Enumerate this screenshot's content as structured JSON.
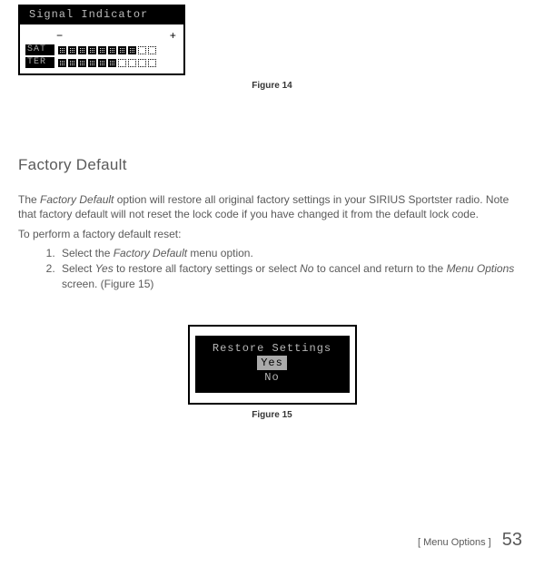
{
  "figure14": {
    "title": "Signal Indicator",
    "minus": "−",
    "plus": "+",
    "rows": {
      "sat": {
        "label": "SAT",
        "filled": 8,
        "empty": 2
      },
      "ter": {
        "label": "TER",
        "filled": 6,
        "empty": 4
      }
    },
    "caption": "Figure 14"
  },
  "section": {
    "heading": "Factory Default",
    "p1a": "The ",
    "p1_em1": "Factory Default",
    "p1b": " option will restore all original factory settings in your SIRIUS Sportster radio. Note that factory default will not reset the lock code if you have changed it from the default lock code.",
    "p2": "To perform a factory default reset:",
    "step1a": "Select the ",
    "step1_em": "Factory Default",
    "step1b": " menu option.",
    "step2a": "Select ",
    "step2_em1": "Yes",
    "step2b": " to restore all factory settings or select ",
    "step2_em2": "No",
    "step2c": " to cancel and return to the ",
    "step2_em3": "Menu Options",
    "step2d": " screen. (Figure 15)"
  },
  "figure15": {
    "line1": "Restore Settings",
    "yes": "Yes",
    "no": "No",
    "caption": "Figure 15"
  },
  "footer": {
    "section": "Menu Options",
    "page": "53"
  }
}
